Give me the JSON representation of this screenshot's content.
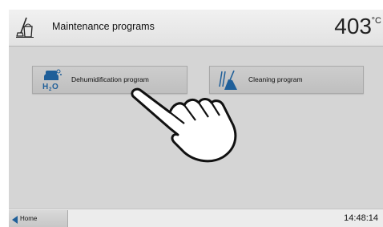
{
  "header": {
    "title": "Maintenance programs",
    "title_icon": "maintenance-bucket-broom-icon",
    "temperature_value": "403",
    "temperature_unit": "°C"
  },
  "programs": [
    {
      "label": "Dehumidification program",
      "icon": "dehumidification-h2o-icon"
    },
    {
      "label": "Cleaning program",
      "icon": "cleaning-brush-icon"
    }
  ],
  "footer": {
    "home_label": "Home",
    "home_icon": "triangle-left-icon",
    "time": "14:48:14"
  },
  "overlay": {
    "icon": "pointing-hand-icon"
  },
  "colors": {
    "accent_blue": "#1f5f99",
    "background": "#d5d5d5",
    "header": "#ebebeb"
  }
}
